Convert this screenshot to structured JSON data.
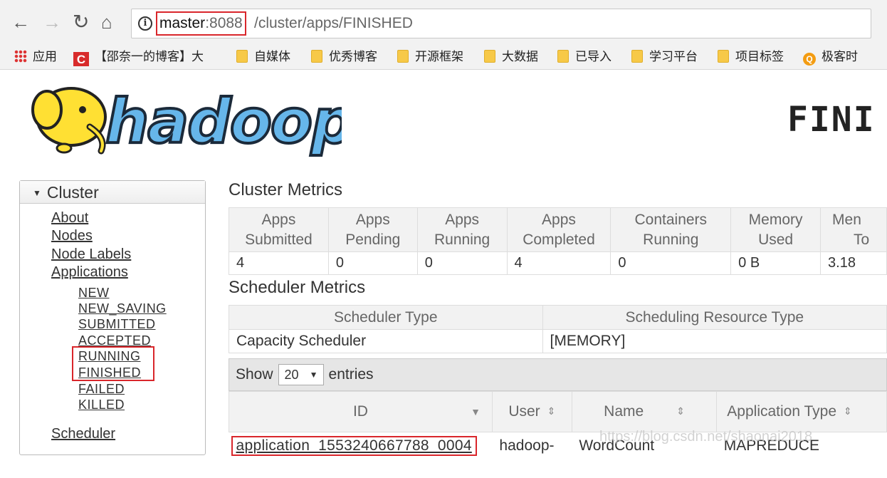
{
  "browser": {
    "url_host": "master",
    "url_port": ":8088",
    "url_path": "/cluster/apps/FINISHED",
    "bookmarks": [
      "应用",
      "【邵奈一的博客】大",
      "自媒体",
      "优秀博客",
      "开源框架",
      "大数据",
      "已导入",
      "学习平台",
      "项目标签",
      "极客时"
    ]
  },
  "header": {
    "logo_text": "hadoop",
    "heading": "FINI"
  },
  "sidebar": {
    "title": "Cluster",
    "links": [
      "About",
      "Nodes",
      "Node Labels",
      "Applications"
    ],
    "states": [
      "NEW",
      "NEW_SAVING",
      "SUBMITTED",
      "ACCEPTED",
      "RUNNING",
      "FINISHED",
      "FAILED",
      "KILLED"
    ],
    "scheduler": "Scheduler"
  },
  "cluster_metrics": {
    "title": "Cluster Metrics",
    "headers": [
      [
        "Apps",
        "Submitted"
      ],
      [
        "Apps",
        "Pending"
      ],
      [
        "Apps",
        "Running"
      ],
      [
        "Apps",
        "Completed"
      ],
      [
        "Containers",
        "Running"
      ],
      [
        "Memory",
        "Used"
      ],
      [
        "Men",
        "To"
      ]
    ],
    "values": [
      "4",
      "0",
      "0",
      "4",
      "0",
      "0 B",
      "3.18"
    ]
  },
  "scheduler_metrics": {
    "title": "Scheduler Metrics",
    "headers": [
      "Scheduler Type",
      "Scheduling Resource Type"
    ],
    "values": [
      "Capacity Scheduler",
      "[MEMORY]"
    ]
  },
  "entries": {
    "show": "Show",
    "count": "20",
    "suffix": "entries"
  },
  "apps_table": {
    "headers": [
      "ID",
      "User",
      "Name",
      "Application Type"
    ],
    "rows": [
      [
        "application_1553240667788_0004",
        "hadoop-",
        "WordCount",
        "MAPREDUCE"
      ]
    ]
  },
  "watermark": "https://blog.csdn.net/shaonai2018"
}
